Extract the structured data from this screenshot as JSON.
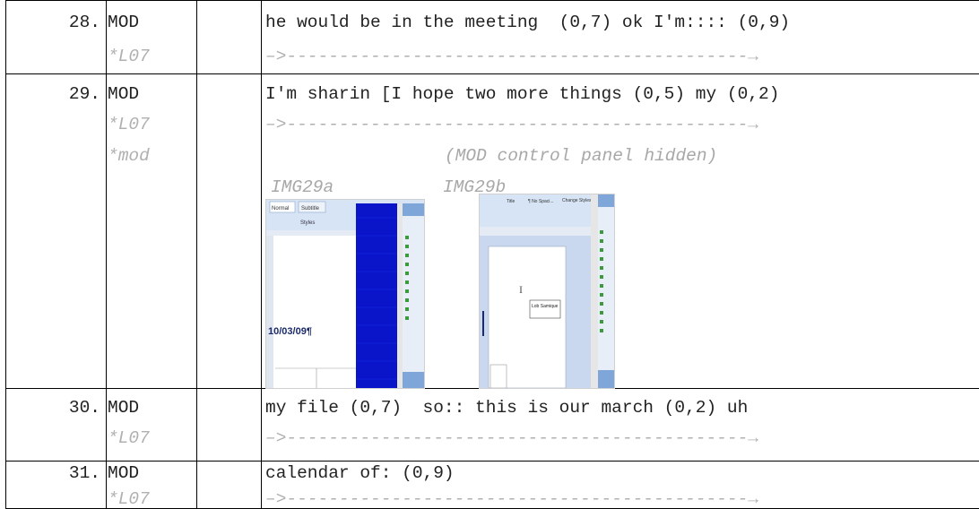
{
  "rows": [
    {
      "num": "28.",
      "speaker": "MOD",
      "tier": "*L07",
      "speech": "he would be in the meeting  (0,7) ok I'm:::: (0,9)",
      "gaze": "–>--------------------------------------------→"
    },
    {
      "num": "29.",
      "speaker": "MOD",
      "tier": "*L07",
      "speech": "I'm sharin [I hope two more things (0,5) my (0,2)",
      "gaze": "–>--------------------------------------------→",
      "tier2": "*mod",
      "note": "(MOD control panel hidden)",
      "img_a_label": "IMG29a",
      "img_b_label": "IMG29b"
    },
    {
      "num": "30.",
      "speaker": "MOD",
      "tier": "*L07",
      "speech": "my file (0,7)  so:: this is our march (0,2) uh",
      "gaze": "–>--------------------------------------------→"
    },
    {
      "num": "31.",
      "speaker": "MOD",
      "tier": "*L07",
      "speech": "calendar of: (0,9)",
      "gaze": "–>--------------------------------------------→"
    }
  ],
  "img_a": {
    "tab1": "Normal",
    "tab2": "Subtitle",
    "group": "Styles",
    "date": "10/03/09¶"
  },
  "img_b": {
    "tab1": "Title",
    "tab2": "¶ No Spaci...",
    "change": "Change Styles",
    "tooltip": "Lob Samique"
  },
  "colors": {
    "blue_panel": "#0a14c8",
    "ribbon": "#d6e4f5",
    "text_gray": "#b0b0b0"
  }
}
